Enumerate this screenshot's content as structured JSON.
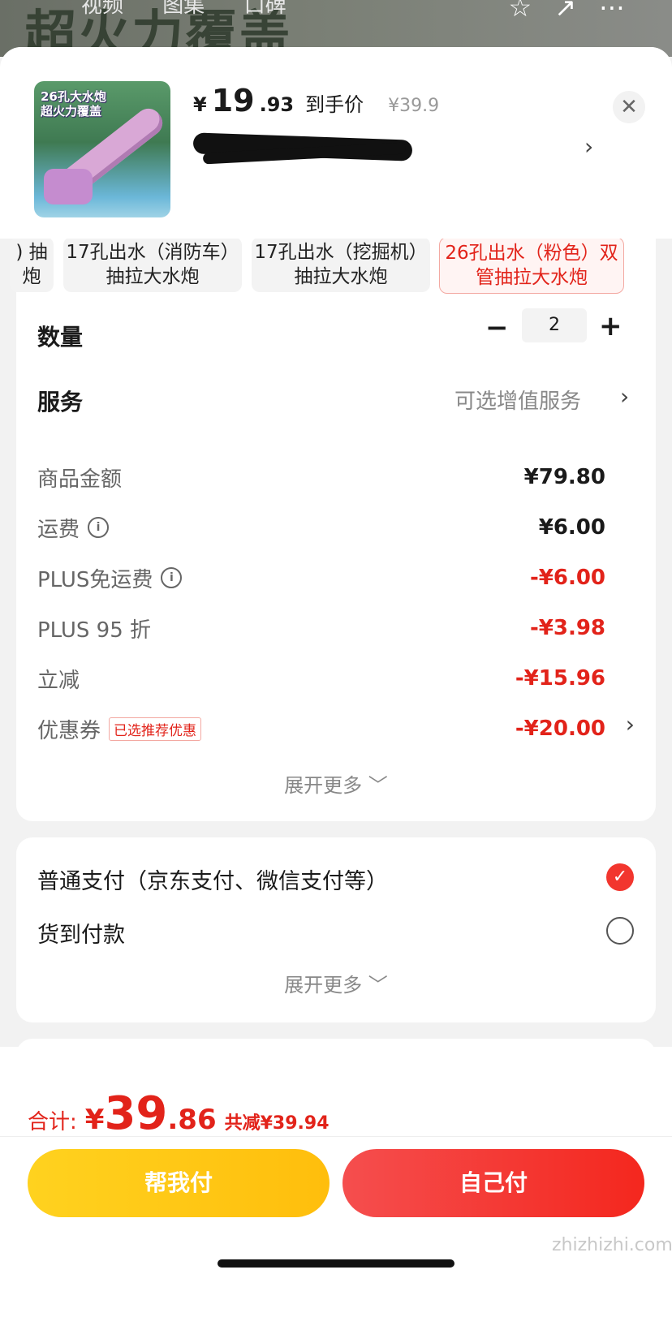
{
  "background": {
    "title": "超火力覆盖",
    "tabs": [
      "视频",
      "图集",
      "口碑"
    ]
  },
  "product": {
    "thumb_text_line1": "26孔大水炮",
    "thumb_text_line2": "超火力覆盖",
    "price_yen": "¥",
    "price_int": "19",
    "price_dec": ".93",
    "price_tag": "到手价",
    "original_price": "¥39.9"
  },
  "specs": [
    {
      "line1": ") 抽",
      "line2": "炮"
    },
    {
      "line1": "17孔出水（消防车）",
      "line2": "抽拉大水炮"
    },
    {
      "line1": "17孔出水（挖掘机）",
      "line2": "抽拉大水炮"
    },
    {
      "line1": "26孔出水（粉色）双",
      "line2": "管抽拉大水炮"
    }
  ],
  "quantity": {
    "label": "数量",
    "value": "2"
  },
  "service": {
    "label": "服务",
    "value": "可选增值服务"
  },
  "fees": {
    "goods": {
      "label": "商品金额",
      "value": "¥79.80"
    },
    "shipping": {
      "label": "运费",
      "value": "¥6.00"
    },
    "plus_free_ship": {
      "label": "PLUS免运费",
      "value": "-¥6.00"
    },
    "plus_discount": {
      "label": "PLUS 95 折",
      "value": "-¥3.98"
    },
    "instant_off": {
      "label": "立减",
      "value": "-¥15.96"
    },
    "coupon": {
      "label": "优惠券",
      "tag": "已选推荐优惠",
      "value": "-¥20.00"
    },
    "expand": "展开更多 ﹀"
  },
  "payment": {
    "option1": "普通支付（京东支付、微信支付等）",
    "option2": "货到付款",
    "expand": "展开更多 ﹀"
  },
  "total": {
    "label": "合计:",
    "yen": "¥",
    "int": "39",
    "dec": ".86",
    "saved": "共减¥39.94"
  },
  "buttons": {
    "help_pay": "帮我付",
    "self_pay": "自己付"
  },
  "watermark": "zhizhizhi.com",
  "colors": {
    "accent": "#e2231a",
    "help_btn": "#ffc713"
  }
}
